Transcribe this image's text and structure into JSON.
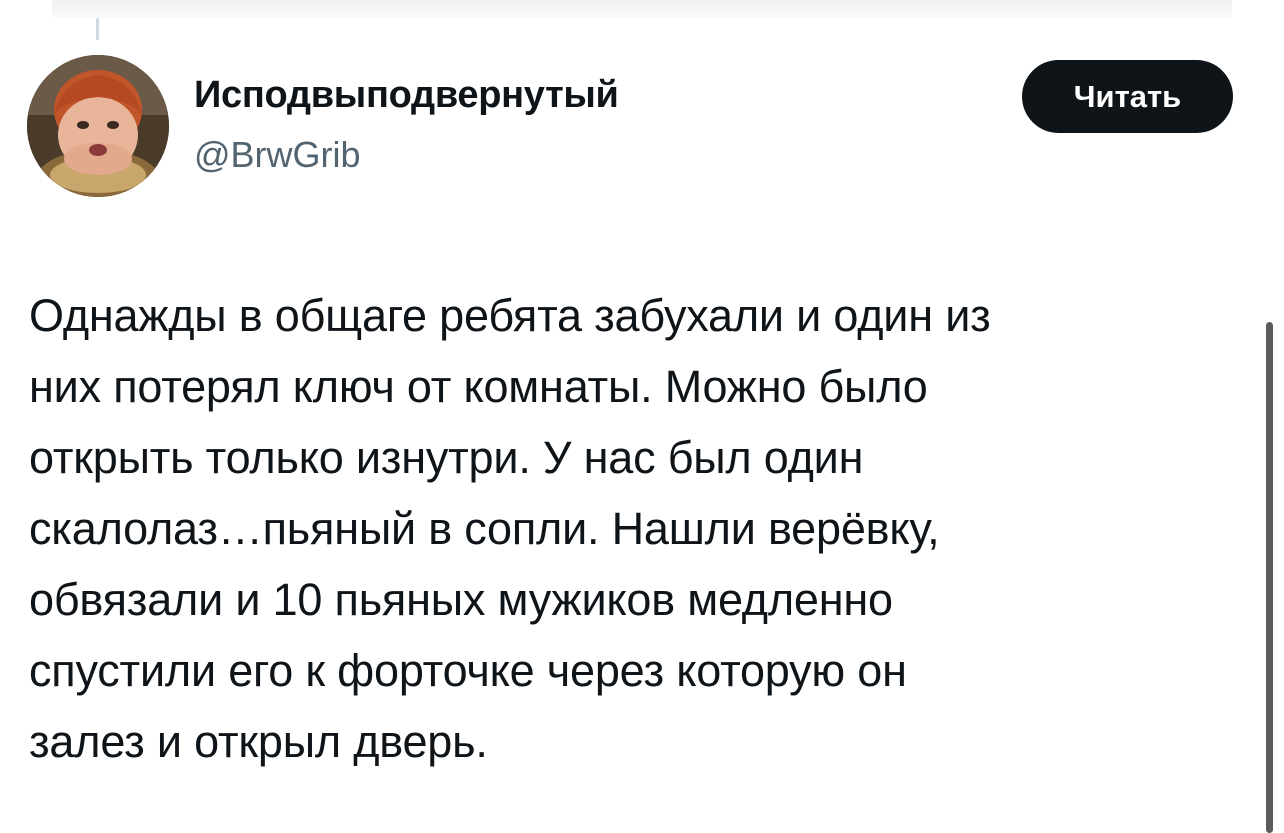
{
  "author": {
    "display_name": "Исподвыподвернутый",
    "handle": "@BrwGrib"
  },
  "follow_button": {
    "label": "Читать"
  },
  "tweet": {
    "text": "Однажды в общаге ребята забухали и один из\nних потерял ключ от комнаты. Можно было\nоткрыть только изнутри. У нас был один\nскалолаз…пьяный в сопли. Нашли верёвку,\nобвязали и 10 пьяных мужиков медленно\nспустили его к форточке через которую он\nзалез и открыл дверь."
  },
  "colors": {
    "text_primary": "#0f1419",
    "text_secondary": "#536471",
    "button_bg": "#0f1419",
    "button_text": "#ffffff"
  }
}
